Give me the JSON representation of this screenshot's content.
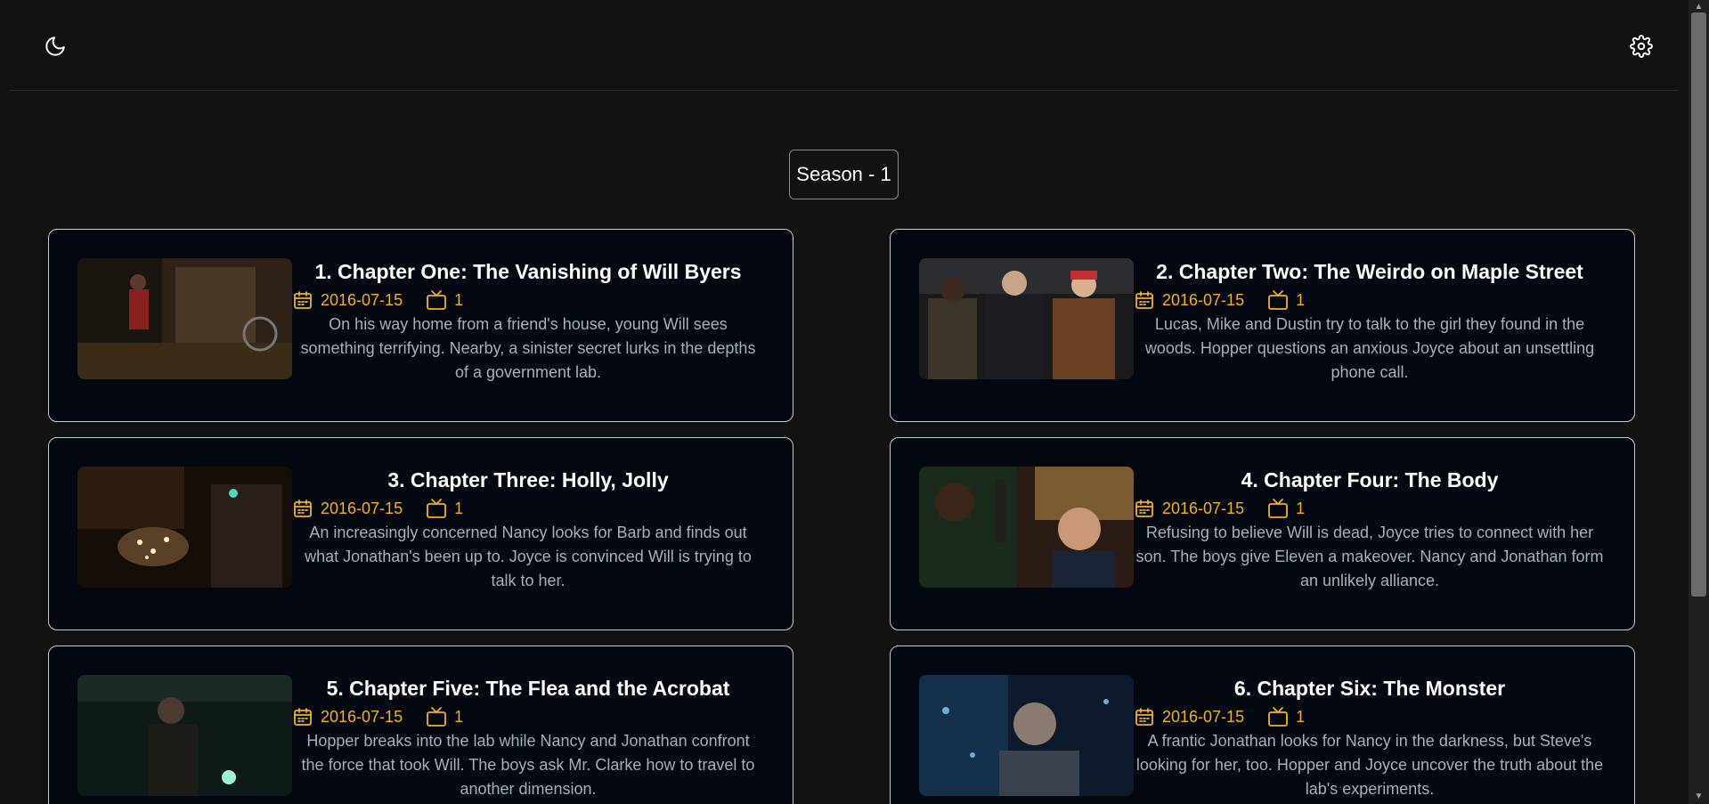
{
  "header": {
    "theme_icon": "moon-icon",
    "settings_icon": "gear-icon"
  },
  "season": {
    "label": "Season - 1"
  },
  "colors": {
    "background": "#121212",
    "card_background": "#020710",
    "accent": "#f2b418",
    "overview_text": "#a9aeb8"
  },
  "episodes": [
    {
      "title": "1. Chapter One: The Vanishing of Will Byers",
      "air_date": "2016-07-15",
      "season_number": "1",
      "overview": "On his way home from a friend's house, young Will sees something terrifying. Nearby, a sinister secret lurks in the depths of a government lab."
    },
    {
      "title": "2. Chapter Two: The Weirdo on Maple Street",
      "air_date": "2016-07-15",
      "season_number": "1",
      "overview": "Lucas, Mike and Dustin try to talk to the girl they found in the woods. Hopper questions an anxious Joyce about an unsettling phone call."
    },
    {
      "title": "3. Chapter Three: Holly, Jolly",
      "air_date": "2016-07-15",
      "season_number": "1",
      "overview": "An increasingly concerned Nancy looks for Barb and finds out what Jonathan's been up to. Joyce is convinced Will is trying to talk to her."
    },
    {
      "title": "4. Chapter Four: The Body",
      "air_date": "2016-07-15",
      "season_number": "1",
      "overview": "Refusing to believe Will is dead, Joyce tries to connect with her son. The boys give Eleven a makeover. Nancy and Jonathan form an unlikely alliance."
    },
    {
      "title": "5. Chapter Five: The Flea and the Acrobat",
      "air_date": "2016-07-15",
      "season_number": "1",
      "overview": "Hopper breaks into the lab while Nancy and Jonathan confront the force that took Will. The boys ask Mr. Clarke how to travel to another dimension."
    },
    {
      "title": "6. Chapter Six: The Monster",
      "air_date": "2016-07-15",
      "season_number": "1",
      "overview": "A frantic Jonathan looks for Nancy in the darkness, but Steve's looking for her, too. Hopper and Joyce uncover the truth about the lab's experiments."
    }
  ]
}
